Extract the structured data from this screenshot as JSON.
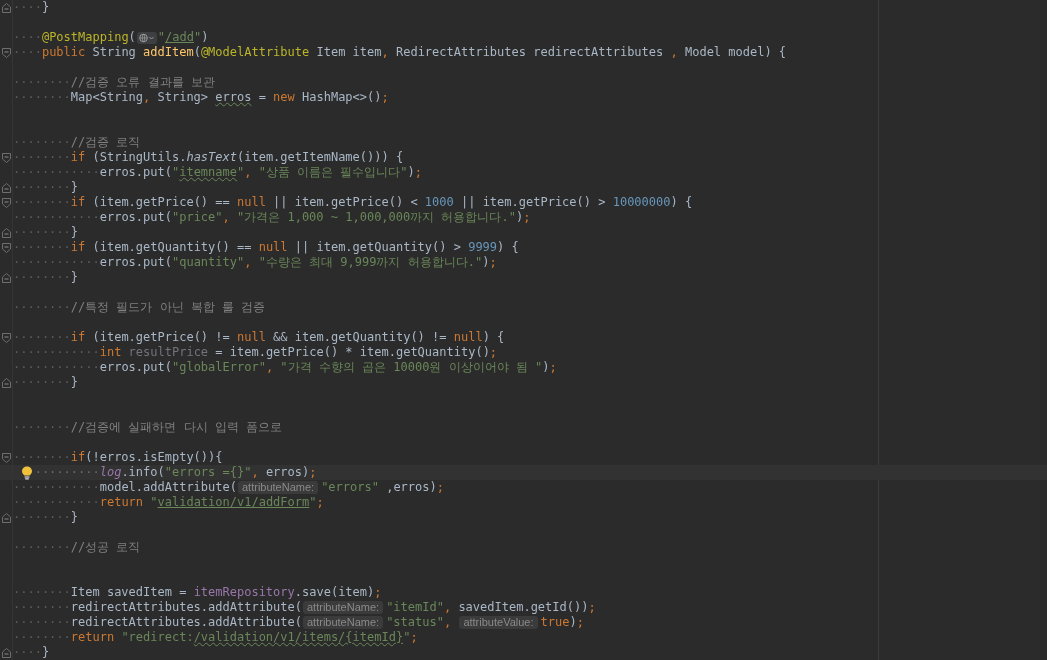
{
  "editor": {
    "lines": [
      {
        "kind": "fold-end",
        "tokens": [
          {
            "kind": "ws",
            "text": "····"
          },
          {
            "kind": "plain",
            "text": "}"
          }
        ]
      },
      {
        "kind": "plain"
      },
      {
        "kind": "plain",
        "tokens": [
          {
            "kind": "ws",
            "text": "····"
          },
          {
            "kind": "ann",
            "text": "@PostMapping"
          },
          {
            "kind": "plain",
            "text": "("
          },
          {
            "kind": "url-icon"
          },
          {
            "kind": "str",
            "text": "\""
          },
          {
            "kind": "link",
            "text": "/add"
          },
          {
            "kind": "str",
            "text": "\""
          },
          {
            "kind": "plain",
            "text": ")"
          }
        ]
      },
      {
        "kind": "fold-start",
        "tokens": [
          {
            "kind": "ws",
            "text": "····"
          },
          {
            "kind": "kw",
            "text": "public "
          },
          {
            "kind": "plain",
            "text": "String "
          },
          {
            "kind": "decl",
            "text": "addItem"
          },
          {
            "kind": "plain",
            "text": "("
          },
          {
            "kind": "ann",
            "text": "@ModelAttribute"
          },
          {
            "kind": "plain",
            "text": " Item item"
          },
          {
            "kind": "kw",
            "text": ", "
          },
          {
            "kind": "plain",
            "text": "RedirectAttributes redirectAttributes "
          },
          {
            "kind": "kw",
            "text": ", "
          },
          {
            "kind": "plain",
            "text": "Model model) {"
          }
        ]
      },
      {
        "kind": "plain"
      },
      {
        "kind": "plain",
        "tokens": [
          {
            "kind": "ws",
            "text": "········"
          },
          {
            "kind": "cmt",
            "text": "//검증 오류 결과를 보관"
          }
        ]
      },
      {
        "kind": "plain",
        "tokens": [
          {
            "kind": "ws",
            "text": "········"
          },
          {
            "kind": "plain",
            "text": "Map<String"
          },
          {
            "kind": "kw",
            "text": ", "
          },
          {
            "kind": "plain",
            "text": "String> "
          },
          {
            "kind": "typo",
            "text": "erros"
          },
          {
            "kind": "plain",
            "text": " = "
          },
          {
            "kind": "kw",
            "text": "new "
          },
          {
            "kind": "plain",
            "text": "HashMap<>()"
          },
          {
            "kind": "kw",
            "text": ";"
          }
        ]
      },
      {
        "kind": "plain"
      },
      {
        "kind": "plain"
      },
      {
        "kind": "plain",
        "tokens": [
          {
            "kind": "ws",
            "text": "········"
          },
          {
            "kind": "cmt",
            "text": "//검증 로직"
          }
        ]
      },
      {
        "kind": "fold-start",
        "tokens": [
          {
            "kind": "ws",
            "text": "········"
          },
          {
            "kind": "kw",
            "text": "if "
          },
          {
            "kind": "plain",
            "text": "(StringUtils."
          },
          {
            "kind": "italic",
            "text": "hasText"
          },
          {
            "kind": "plain",
            "text": "(item.getItemName())) {"
          }
        ]
      },
      {
        "kind": "plain",
        "tokens": [
          {
            "kind": "ws",
            "text": "············"
          },
          {
            "kind": "plain",
            "text": "erros.put("
          },
          {
            "kind": "str",
            "text": "\""
          },
          {
            "kind": "str-typo",
            "text": "itemname"
          },
          {
            "kind": "str",
            "text": "\""
          },
          {
            "kind": "kw",
            "text": ", "
          },
          {
            "kind": "str",
            "text": "\"상품 이름은 필수입니다\""
          },
          {
            "kind": "plain",
            "text": ")"
          },
          {
            "kind": "kw",
            "text": ";"
          }
        ]
      },
      {
        "kind": "fold-end",
        "tokens": [
          {
            "kind": "ws",
            "text": "········"
          },
          {
            "kind": "plain",
            "text": "}"
          }
        ]
      },
      {
        "kind": "fold-start",
        "tokens": [
          {
            "kind": "ws",
            "text": "········"
          },
          {
            "kind": "kw",
            "text": "if "
          },
          {
            "kind": "plain",
            "text": "(item.getPrice() == "
          },
          {
            "kind": "kw",
            "text": "null "
          },
          {
            "kind": "plain",
            "text": "|| item.getPrice() < "
          },
          {
            "kind": "num",
            "text": "1000"
          },
          {
            "kind": "plain",
            "text": " || item.getPrice() > "
          },
          {
            "kind": "num",
            "text": "10000000"
          },
          {
            "kind": "plain",
            "text": ") {"
          }
        ]
      },
      {
        "kind": "plain",
        "tokens": [
          {
            "kind": "ws",
            "text": "············"
          },
          {
            "kind": "plain",
            "text": "erros.put("
          },
          {
            "kind": "str",
            "text": "\"price\""
          },
          {
            "kind": "kw",
            "text": ", "
          },
          {
            "kind": "str",
            "text": "\"가격은 1,000 ~ 1,000,000까지 허용합니다.\""
          },
          {
            "kind": "plain",
            "text": ")"
          },
          {
            "kind": "kw",
            "text": ";"
          }
        ]
      },
      {
        "kind": "fold-end",
        "tokens": [
          {
            "kind": "ws",
            "text": "········"
          },
          {
            "kind": "plain",
            "text": "}"
          }
        ]
      },
      {
        "kind": "fold-start",
        "tokens": [
          {
            "kind": "ws",
            "text": "········"
          },
          {
            "kind": "kw",
            "text": "if "
          },
          {
            "kind": "plain",
            "text": "(item.getQuantity() == "
          },
          {
            "kind": "kw",
            "text": "null "
          },
          {
            "kind": "plain",
            "text": "|| item.getQuantity() > "
          },
          {
            "kind": "num",
            "text": "9999"
          },
          {
            "kind": "plain",
            "text": ") {"
          }
        ]
      },
      {
        "kind": "plain",
        "tokens": [
          {
            "kind": "ws",
            "text": "············"
          },
          {
            "kind": "plain",
            "text": "erros.put("
          },
          {
            "kind": "str",
            "text": "\"quantity\""
          },
          {
            "kind": "kw",
            "text": ", "
          },
          {
            "kind": "str",
            "text": "\"수량은 최대 9,999까지 허용합니다.\""
          },
          {
            "kind": "plain",
            "text": ")"
          },
          {
            "kind": "kw",
            "text": ";"
          }
        ]
      },
      {
        "kind": "fold-end",
        "tokens": [
          {
            "kind": "ws",
            "text": "········"
          },
          {
            "kind": "plain",
            "text": "}"
          }
        ]
      },
      {
        "kind": "plain"
      },
      {
        "kind": "plain",
        "tokens": [
          {
            "kind": "ws",
            "text": "········"
          },
          {
            "kind": "cmt",
            "text": "//특정 필드가 아닌 복합 룰 검증"
          }
        ]
      },
      {
        "kind": "plain"
      },
      {
        "kind": "fold-start",
        "tokens": [
          {
            "kind": "ws",
            "text": "········"
          },
          {
            "kind": "kw",
            "text": "if "
          },
          {
            "kind": "plain",
            "text": "(item.getPrice() != "
          },
          {
            "kind": "kw",
            "text": "null "
          },
          {
            "kind": "plain",
            "text": "&& item.getQuantity() != "
          },
          {
            "kind": "kw",
            "text": "null"
          },
          {
            "kind": "plain",
            "text": ") {"
          }
        ]
      },
      {
        "kind": "plain",
        "tokens": [
          {
            "kind": "ws",
            "text": "············"
          },
          {
            "kind": "kw",
            "text": "int "
          },
          {
            "kind": "unused",
            "text": "resultPrice"
          },
          {
            "kind": "plain",
            "text": " = item.getPrice() * item.getQuantity()"
          },
          {
            "kind": "kw",
            "text": ";"
          }
        ]
      },
      {
        "kind": "plain",
        "tokens": [
          {
            "kind": "ws",
            "text": "············"
          },
          {
            "kind": "plain",
            "text": "erros.put("
          },
          {
            "kind": "str",
            "text": "\"globalError\""
          },
          {
            "kind": "kw",
            "text": ", "
          },
          {
            "kind": "str",
            "text": "\"가격 수향의 곱은 10000원 이상이어야 됨 \""
          },
          {
            "kind": "plain",
            "text": ")"
          },
          {
            "kind": "kw",
            "text": ";"
          }
        ]
      },
      {
        "kind": "fold-end",
        "tokens": [
          {
            "kind": "ws",
            "text": "········"
          },
          {
            "kind": "plain",
            "text": "}"
          }
        ]
      },
      {
        "kind": "plain"
      },
      {
        "kind": "plain"
      },
      {
        "kind": "plain",
        "tokens": [
          {
            "kind": "ws",
            "text": "········"
          },
          {
            "kind": "cmt",
            "text": "//검증에 실패하면 다시 입력 폼으로"
          }
        ]
      },
      {
        "kind": "plain"
      },
      {
        "kind": "fold-start",
        "tokens": [
          {
            "kind": "ws",
            "text": "········"
          },
          {
            "kind": "kw",
            "text": "if"
          },
          {
            "kind": "plain",
            "text": "(!erros.isEmpty()){"
          }
        ]
      },
      {
        "kind": "plain",
        "current": true,
        "bulb": true,
        "tokens": [
          {
            "kind": "ws",
            "text": "·········"
          },
          {
            "kind": "static",
            "text": "log"
          },
          {
            "kind": "plain",
            "text": ".info("
          },
          {
            "kind": "str",
            "text": "\"errors ={}\""
          },
          {
            "kind": "kw",
            "text": ", "
          },
          {
            "kind": "plain",
            "text": "erros)"
          },
          {
            "kind": "kw",
            "text": ";"
          }
        ]
      },
      {
        "kind": "plain",
        "tokens": [
          {
            "kind": "ws",
            "text": "············"
          },
          {
            "kind": "plain",
            "text": "model.addAttribute("
          },
          {
            "kind": "hint",
            "text": "attributeName:"
          },
          {
            "kind": "str",
            "text": "\"errors\""
          },
          {
            "kind": "plain",
            "text": " ,erros)"
          },
          {
            "kind": "kw",
            "text": ";"
          }
        ]
      },
      {
        "kind": "plain",
        "tokens": [
          {
            "kind": "ws",
            "text": "············"
          },
          {
            "kind": "kw",
            "text": "return "
          },
          {
            "kind": "str",
            "text": "\""
          },
          {
            "kind": "link",
            "text": "validation/v1/addForm"
          },
          {
            "kind": "str",
            "text": "\""
          },
          {
            "kind": "kw",
            "text": ";"
          }
        ]
      },
      {
        "kind": "fold-end",
        "tokens": [
          {
            "kind": "ws",
            "text": "········"
          },
          {
            "kind": "plain",
            "text": "}"
          }
        ]
      },
      {
        "kind": "plain"
      },
      {
        "kind": "plain",
        "tokens": [
          {
            "kind": "ws",
            "text": "········"
          },
          {
            "kind": "cmt",
            "text": "//성공 로직"
          }
        ]
      },
      {
        "kind": "plain"
      },
      {
        "kind": "plain"
      },
      {
        "kind": "plain",
        "tokens": [
          {
            "kind": "ws",
            "text": "········"
          },
          {
            "kind": "plain",
            "text": "Item savedItem = "
          },
          {
            "kind": "field",
            "text": "itemRepository"
          },
          {
            "kind": "plain",
            "text": ".save(item)"
          },
          {
            "kind": "kw",
            "text": ";"
          }
        ]
      },
      {
        "kind": "plain",
        "tokens": [
          {
            "kind": "ws",
            "text": "········"
          },
          {
            "kind": "plain",
            "text": "redirectAttributes.addAttribute("
          },
          {
            "kind": "hint",
            "text": "attributeName:"
          },
          {
            "kind": "str",
            "text": "\"itemId\""
          },
          {
            "kind": "kw",
            "text": ", "
          },
          {
            "kind": "plain",
            "text": "savedItem.getId())"
          },
          {
            "kind": "kw",
            "text": ";"
          }
        ]
      },
      {
        "kind": "plain",
        "tokens": [
          {
            "kind": "ws",
            "text": "········"
          },
          {
            "kind": "plain",
            "text": "redirectAttributes.addAttribute("
          },
          {
            "kind": "hint",
            "text": "attributeName:"
          },
          {
            "kind": "str",
            "text": "\"status\""
          },
          {
            "kind": "kw",
            "text": ", "
          },
          {
            "kind": "hint",
            "text": "attributeValue:"
          },
          {
            "kind": "kw",
            "text": "true"
          },
          {
            "kind": "plain",
            "text": ")"
          },
          {
            "kind": "kw",
            "text": ";"
          }
        ]
      },
      {
        "kind": "plain",
        "tokens": [
          {
            "kind": "ws",
            "text": "········"
          },
          {
            "kind": "kw",
            "text": "return "
          },
          {
            "kind": "str",
            "text": "\"redirect:"
          },
          {
            "kind": "link-typo",
            "text": "/validation/v1/items/{itemId}"
          },
          {
            "kind": "str",
            "text": "\""
          },
          {
            "kind": "kw",
            "text": ";"
          }
        ]
      },
      {
        "kind": "fold-end",
        "tokens": [
          {
            "kind": "ws",
            "text": "····"
          },
          {
            "kind": "plain",
            "text": "}"
          }
        ]
      }
    ]
  }
}
